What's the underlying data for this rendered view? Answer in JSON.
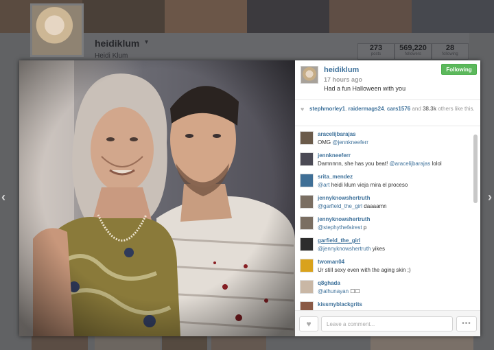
{
  "profile": {
    "username": "heidiklum",
    "full_name": "Heidi Klum",
    "stats": [
      {
        "value": "273",
        "label": "posts"
      },
      {
        "value": "569,220",
        "label": "followers"
      },
      {
        "value": "28",
        "label": "following"
      }
    ]
  },
  "post": {
    "username": "heidiklum",
    "time": "17 hours ago",
    "caption": "Had a fun Halloween with you",
    "follow_label": "Following",
    "likes": {
      "users": [
        "stephmorley1",
        "raidermags24",
        "cars1576"
      ],
      "others": "38.3k",
      "and_word": "and",
      "others_word": "others",
      "suffix": "like this."
    },
    "comments": [
      {
        "user": "aracelijbarajas",
        "mention": "",
        "text": "OMG ",
        "mention_after": "@jennkneeferr",
        "avatar_color": "#6b5b4b"
      },
      {
        "user": "jennkneeferr",
        "mention": "",
        "text": "Damnnnn, she has you beat! ",
        "mention_after": "@aracelijbarajas",
        "trail": " lolol",
        "avatar_color": "#4b4a55"
      },
      {
        "user": "srita_mendez",
        "mention": "@art",
        "text": " heidi klum vieja mira el proceso",
        "mention_after": "",
        "avatar_color": "#3f6f96"
      },
      {
        "user": "jennyknowshertruth",
        "mention": "@garfield_the_girl",
        "text": " daaaamn",
        "mention_after": "",
        "avatar_color": "#7a6e62"
      },
      {
        "user": "jennyknowshertruth",
        "mention": "@stephythefairest",
        "text": " p",
        "mention_after": "",
        "avatar_color": "#7a6e62"
      },
      {
        "user": "garfield_the_girl",
        "mention": "@jennyknowshertruth",
        "text": " yikes",
        "mention_after": "",
        "avatar_color": "#2d2d2d"
      },
      {
        "user": "twoman04",
        "mention": "",
        "text": "Ur still sexy even with the aging skin ;)",
        "mention_after": "",
        "avatar_color": "#d9a21c"
      },
      {
        "user": "q8ghada",
        "mention": "@alhunayan",
        "text": " ☐☐",
        "mention_after": "",
        "avatar_color": "#c9b7a5"
      },
      {
        "user": "kissmyblackgrits",
        "mention": "",
        "text": "",
        "mention_after": "",
        "avatar_color": "#8a5a46"
      }
    ],
    "comment_placeholder": "Leave a comment...",
    "more_label": "•••"
  },
  "icons": {
    "heart": "♥",
    "caret": "▾",
    "prev": "‹",
    "next": "›"
  },
  "colors": {
    "link_blue": "#3f729b",
    "follow_green": "#5cb85c",
    "overlay": "#3e3f42"
  }
}
